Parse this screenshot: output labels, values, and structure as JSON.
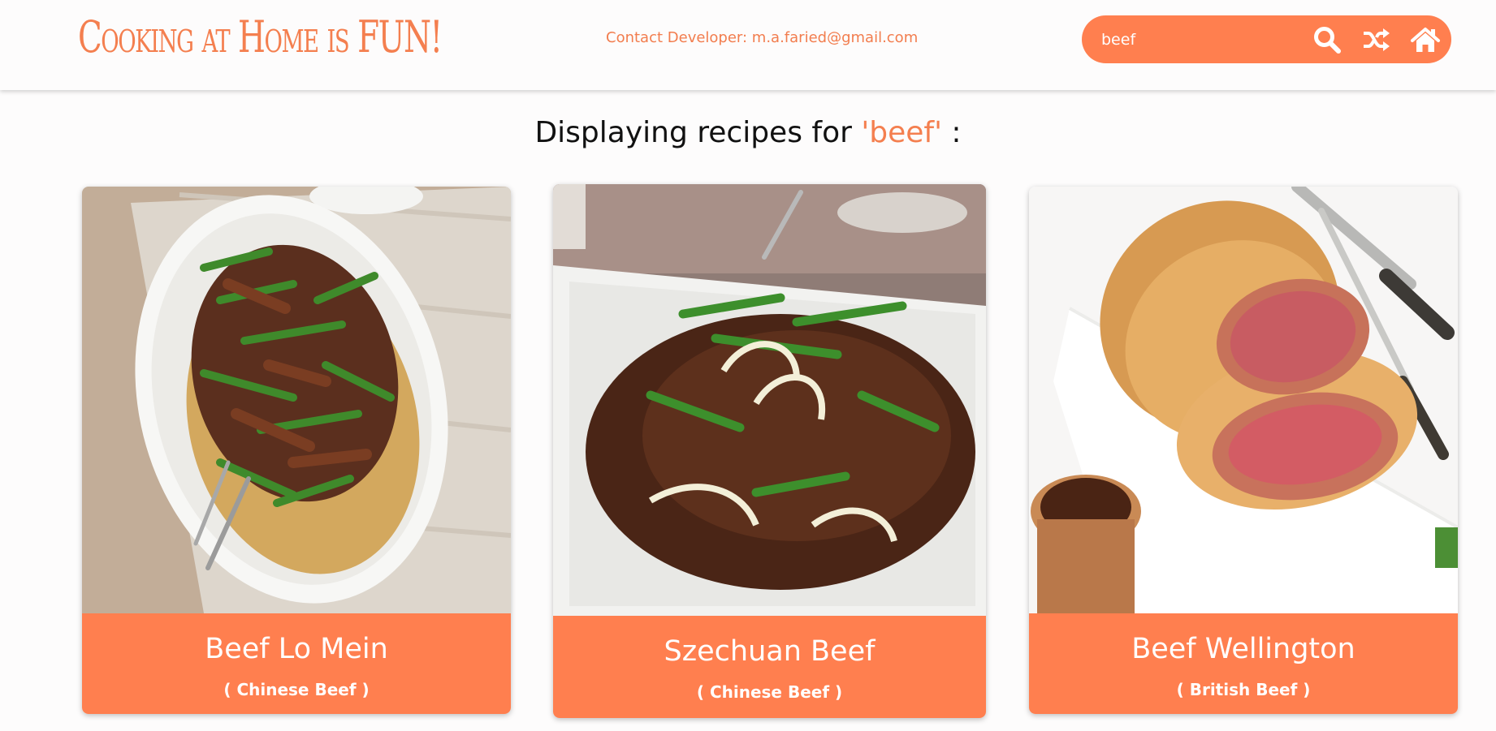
{
  "header": {
    "logo_text": "Cooking at Home is FUN!",
    "contact_text": "Contact Developer: m.a.faried@gmail.com"
  },
  "search": {
    "value": "beef",
    "placeholder": "",
    "icons": {
      "search": "search-icon",
      "random": "shuffle-icon",
      "home": "home-icon"
    }
  },
  "results": {
    "prefix": "Displaying recipes for ",
    "query": "'beef'",
    "suffix": " :"
  },
  "recipes": [
    {
      "title": "Beef Lo Mein",
      "subtitle": "( Chinese Beef )"
    },
    {
      "title": "Szechuan Beef",
      "subtitle": "( Chinese Beef )"
    },
    {
      "title": "Beef Wellington",
      "subtitle": "( British Beef )"
    }
  ],
  "colors": {
    "accent": "#ff7f4f",
    "logo": "#f47f4f",
    "background": "#fdfcfc",
    "text": "#111111"
  }
}
